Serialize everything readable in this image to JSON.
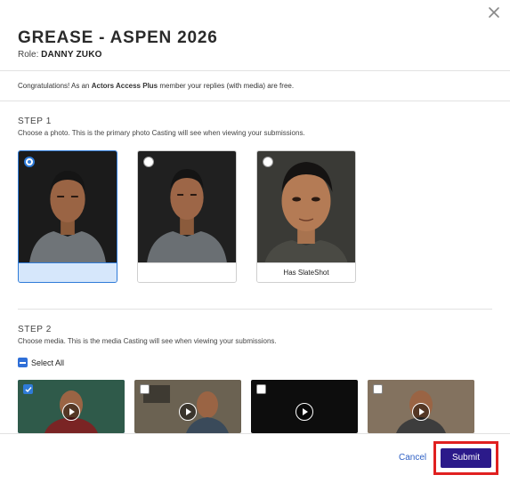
{
  "header": {
    "title": "GREASE - ASPEN 2026",
    "role_label": "Role:",
    "role_value": "DANNY ZUKO"
  },
  "notice": {
    "prefix": "Congratulations! As an ",
    "highlight": "Actors Access Plus",
    "suffix": " member your replies (with media) are free."
  },
  "step1": {
    "title": "STEP 1",
    "description": "Choose a photo. This is the primary photo Casting will see when viewing your submissions.",
    "photos": [
      {
        "caption": "",
        "selected": true
      },
      {
        "caption": "",
        "selected": false
      },
      {
        "caption": "Has SlateShot",
        "selected": false
      }
    ]
  },
  "step2": {
    "title": "STEP 2",
    "description": "Choose media. This is the media Casting will see when viewing your submissions.",
    "select_all_label": "Select All",
    "media": [
      {
        "checked": true
      },
      {
        "checked": false
      },
      {
        "checked": false
      },
      {
        "checked": false
      }
    ]
  },
  "footer": {
    "cancel_label": "Cancel",
    "submit_label": "Submit"
  },
  "colors": {
    "accent": "#2f7bd8",
    "submit_bg": "#2b1a8a",
    "highlight_outline": "#e02020",
    "link": "#2d5fc4"
  }
}
